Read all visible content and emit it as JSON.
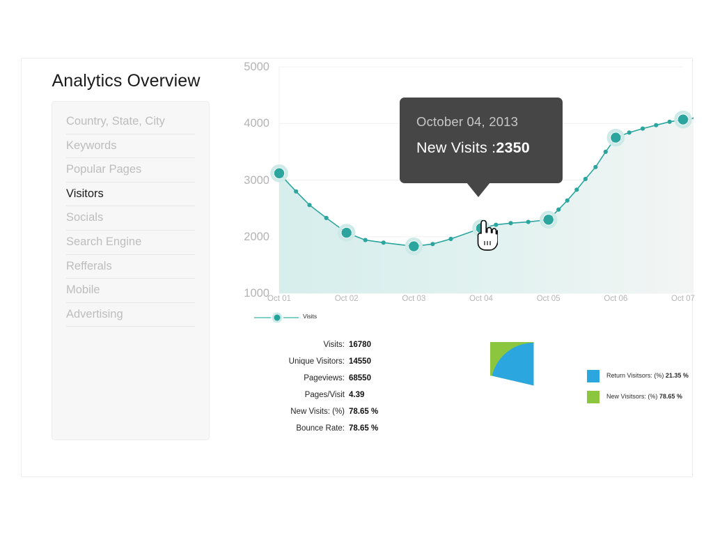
{
  "page": {
    "title": "Analytics Overview"
  },
  "sidebar": {
    "items": [
      {
        "label": "Country, State, City",
        "active": false
      },
      {
        "label": "Keywords",
        "active": false
      },
      {
        "label": "Popular Pages",
        "active": false
      },
      {
        "label": "Visitors",
        "active": true
      },
      {
        "label": "Socials",
        "active": false
      },
      {
        "label": "Search Engine",
        "active": false
      },
      {
        "label": "Refferals",
        "active": false
      },
      {
        "label": "Mobile",
        "active": false
      },
      {
        "label": "Advertising",
        "active": false
      }
    ]
  },
  "tooltip": {
    "date": "October 04, 2013",
    "metric_label": "New Visits :",
    "metric_value": "2350"
  },
  "stats": {
    "rows": [
      {
        "label": "Visits:",
        "value": "16780"
      },
      {
        "label": "Unique Visitors:",
        "value": "14550"
      },
      {
        "label": "Pageviews:",
        "value": "68550"
      },
      {
        "label": "Pages/Visit",
        "value": "4.39"
      },
      {
        "label": "New Visits: (%)",
        "value": "78.65 %"
      },
      {
        "label": "Bounce Rate:",
        "value": "78.65 %"
      }
    ]
  },
  "colors": {
    "line_teal": "#2ba59e",
    "line_teal_light": "#a9ddd9",
    "area_fill": "#d9efed",
    "pie_blue": "#2ba6de",
    "pie_green": "#8cc63f",
    "tooltip_bg": "#464646",
    "axis_text": "#b3b3b3",
    "nav_inactive": "#bdbdbd",
    "nav_active": "#1a1a1a"
  },
  "chart_data": {
    "type": "line",
    "title": "",
    "xlabel": "",
    "ylabel": "",
    "ylim": [
      1000,
      5000
    ],
    "yticks": [
      1000,
      2000,
      3000,
      4000,
      5000
    ],
    "grid": true,
    "legend": [
      {
        "name": "Visits",
        "color": "#2ba59e"
      }
    ],
    "legend_position": "bottom-left",
    "categories": [
      "Oct 01",
      "Oct 02",
      "Oct 03",
      "Oct 04",
      "Oct 05",
      "Oct 06",
      "Oct 07"
    ],
    "values": [
      3120,
      2070,
      1830,
      2150,
      2300,
      3750,
      4070
    ],
    "annotation": {
      "point_index": 3,
      "date": "October 04, 2013",
      "label": "New Visits",
      "value": 2350
    },
    "interpolated_points": [
      {
        "x": 0.0,
        "y": 3120
      },
      {
        "x": 0.25,
        "y": 2800
      },
      {
        "x": 0.45,
        "y": 2560
      },
      {
        "x": 0.7,
        "y": 2330
      },
      {
        "x": 1.0,
        "y": 2070
      },
      {
        "x": 1.28,
        "y": 1940
      },
      {
        "x": 1.55,
        "y": 1895
      },
      {
        "x": 2.0,
        "y": 1830
      },
      {
        "x": 2.28,
        "y": 1870
      },
      {
        "x": 2.55,
        "y": 1960
      },
      {
        "x": 3.0,
        "y": 2150
      },
      {
        "x": 3.22,
        "y": 2210
      },
      {
        "x": 3.44,
        "y": 2240
      },
      {
        "x": 3.7,
        "y": 2260
      },
      {
        "x": 4.0,
        "y": 2300
      },
      {
        "x": 4.15,
        "y": 2480
      },
      {
        "x": 4.28,
        "y": 2640
      },
      {
        "x": 4.42,
        "y": 2830
      },
      {
        "x": 4.55,
        "y": 3020
      },
      {
        "x": 4.7,
        "y": 3230
      },
      {
        "x": 4.85,
        "y": 3500
      },
      {
        "x": 5.0,
        "y": 3750
      },
      {
        "x": 5.2,
        "y": 3840
      },
      {
        "x": 5.4,
        "y": 3910
      },
      {
        "x": 5.6,
        "y": 3970
      },
      {
        "x": 5.8,
        "y": 4030
      },
      {
        "x": 6.0,
        "y": 4070
      },
      {
        "x": 6.18,
        "y": 4095
      }
    ]
  },
  "pie_chart": {
    "type": "pie",
    "slices": [
      {
        "name": "Return Visitsors: (%)",
        "value": 21.35,
        "display": "21.35 %",
        "color": "#2ba6de"
      },
      {
        "name": "New Visitsors: (%)",
        "value": 78.65,
        "display": "78.65 %",
        "color": "#8cc63f"
      }
    ]
  }
}
